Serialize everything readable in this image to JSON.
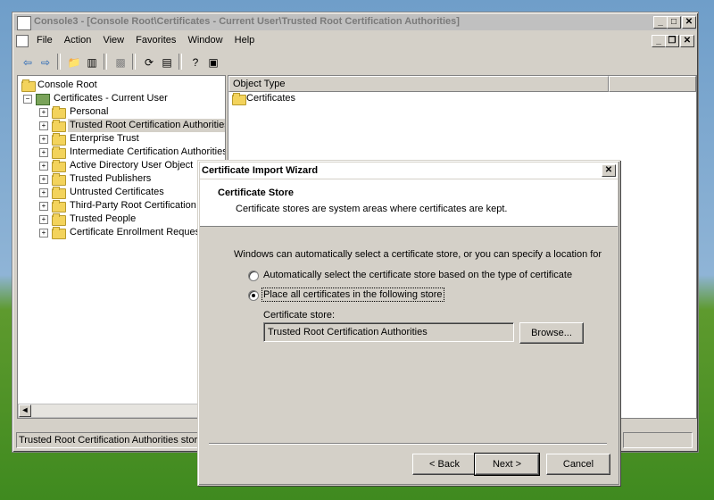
{
  "console": {
    "title": "Console3 - [Console Root\\Certificates - Current User\\Trusted Root Certification Authorities]",
    "menu": [
      "File",
      "Action",
      "View",
      "Favorites",
      "Window",
      "Help"
    ],
    "tree": {
      "root": "Console Root",
      "store": "Certificates - Current User",
      "items": [
        "Personal",
        "Trusted Root Certification Authorities",
        "Enterprise Trust",
        "Intermediate Certification Authorities",
        "Active Directory User Object",
        "Trusted Publishers",
        "Untrusted Certificates",
        "Third-Party Root Certification Au",
        "Trusted People",
        "Certificate Enrollment Requests"
      ]
    },
    "list": {
      "column_header": "Object Type",
      "items": [
        "Certificates"
      ]
    },
    "status_text": "Trusted Root Certification Authorities store c"
  },
  "dialog": {
    "title": "Certificate Import Wizard",
    "header_title": "Certificate Store",
    "header_subtitle": "Certificate stores are system areas where certificates are kept.",
    "intro": "Windows can automatically select a certificate store, or you can specify a location for",
    "option_auto": "Automatically select the certificate store based on the type of certificate",
    "option_place": "Place all certificates in the following store",
    "selected_option": "place",
    "store_label": "Certificate store:",
    "store_value": "Trusted Root Certification Authorities",
    "browse_label": "Browse...",
    "back_label": "< Back",
    "next_label": "Next >",
    "cancel_label": "Cancel",
    "close_glyph": "✕"
  }
}
